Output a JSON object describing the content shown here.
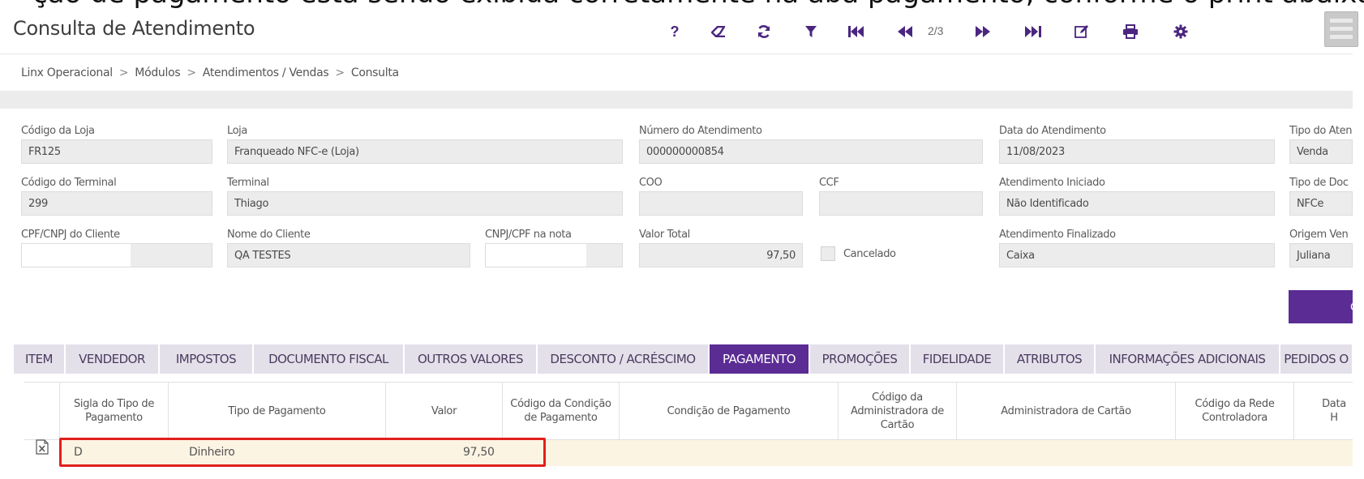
{
  "caption": "ção de pagamento está sendo exibida corretamente na aba pagamento, conforme o print abaixo",
  "header": {
    "title": "Consulta de Atendimento",
    "toolbar": {
      "help": "?",
      "pager": "2/3"
    }
  },
  "breadcrumb": {
    "items": [
      "Linx Operacional",
      "Módulos",
      "Atendimentos / Vendas",
      "Consulta"
    ],
    "separator": ">"
  },
  "form": {
    "codigo_loja": {
      "label": "Código da Loja",
      "value": "FR125"
    },
    "loja": {
      "label": "Loja",
      "value": "Franqueado NFC-e (Loja)"
    },
    "numero_atendimento": {
      "label": "Número do Atendimento",
      "value": "000000000854"
    },
    "data_atendimento": {
      "label": "Data do Atendimento",
      "value": "11/08/2023"
    },
    "tipo_atendimento": {
      "label": "Tipo do Aten",
      "value": "Venda"
    },
    "codigo_terminal": {
      "label": "Código do Terminal",
      "value": "299"
    },
    "terminal": {
      "label": "Terminal",
      "value": "Thiago"
    },
    "coo": {
      "label": "COO",
      "value": ""
    },
    "ccf": {
      "label": "CCF",
      "value": ""
    },
    "atendimento_iniciado": {
      "label": "Atendimento Iniciado",
      "value": "Não Identificado"
    },
    "tipo_documento": {
      "label": "Tipo de Doc",
      "value": "NFCe"
    },
    "cpf_cliente": {
      "label": "CPF/CNPJ do Cliente",
      "value": ""
    },
    "nome_cliente": {
      "label": "Nome do Cliente",
      "value": "QA TESTES"
    },
    "cpf_nota": {
      "label": "CNPJ/CPF na nota",
      "value": ""
    },
    "valor_total": {
      "label": "Valor Total",
      "value": "97,50"
    },
    "cancelado": {
      "label": "Cancelado",
      "checked": false
    },
    "atendimento_finalizado": {
      "label": "Atendimento Finalizado",
      "value": "Caixa"
    },
    "origem_venda": {
      "label": "Origem Ven",
      "value": "Juliana"
    },
    "action_button": {
      "label": "C"
    }
  },
  "tabs": [
    {
      "label": "ITEM",
      "active": false
    },
    {
      "label": "VENDEDOR",
      "active": false
    },
    {
      "label": "IMPOSTOS",
      "active": false
    },
    {
      "label": "DOCUMENTO FISCAL",
      "active": false
    },
    {
      "label": "OUTROS VALORES",
      "active": false
    },
    {
      "label": "DESCONTO / ACRÉSCIMO",
      "active": false
    },
    {
      "label": "PAGAMENTO",
      "active": true
    },
    {
      "label": "PROMOÇÕES",
      "active": false
    },
    {
      "label": "FIDELIDADE",
      "active": false
    },
    {
      "label": "ATRIBUTOS",
      "active": false
    },
    {
      "label": "INFORMAÇÕES ADICIONAIS",
      "active": false
    },
    {
      "label": "PEDIDOS O",
      "active": false
    }
  ],
  "grid": {
    "columns": [
      "Sigla do Tipo de Pagamento",
      "Tipo de Pagamento",
      "Valor",
      "Código da Condição de Pagamento",
      "Condição de Pagamento",
      "Código da Administradora de Cartão",
      "Administradora de Cartão",
      "Código da Rede Controladora",
      "Data H"
    ],
    "rows": [
      {
        "sigla": "D",
        "tipo": "Dinheiro",
        "valor": "97,50"
      }
    ]
  },
  "colors": {
    "accent": "#5b2c94",
    "highlight": "#e0201c",
    "row_bg": "#fcf4e3"
  }
}
